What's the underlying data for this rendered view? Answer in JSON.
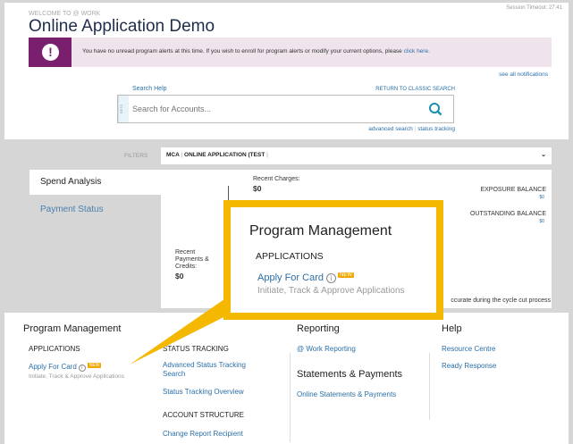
{
  "header": {
    "welcome": "WELCOME TO @ WORK",
    "title": "Online Application Demo",
    "session_timeout": "Session Timeout: 27:41"
  },
  "alert": {
    "icon": "exclamation-icon",
    "message": "You have no unread program alerts at this time. If you wish to enroll for program alerts or modify your current options, please",
    "link": "click here.",
    "see_all": "see all notifications"
  },
  "search": {
    "help": "Search Help",
    "classic": "RETURN TO CLASSIC SEARCH",
    "beta": "BETA",
    "placeholder": "Search for Accounts...",
    "advanced": "advanced search",
    "separator": "|",
    "status_tracking": "status tracking"
  },
  "filters": {
    "label": "FILTERS",
    "value_1": "MCA",
    "value_2": "ONLINE APPLICATION (TEST"
  },
  "side_tabs": [
    {
      "label": "Spend Analysis"
    },
    {
      "label": "Payment Status"
    }
  ],
  "summary": {
    "recent_charges_label": "Recent Charges:",
    "recent_charges": "$0",
    "recent_payments_label": "Recent Payments & Credits:",
    "recent_payments": "$0",
    "exposure_label": "EXPOSURE BALANCE",
    "exposure": "$0",
    "outstanding_label": "OUTSTANDING BALANCE",
    "outstanding": "$0",
    "note": "ccurate during the cycle cut process"
  },
  "callout": {
    "title": "Program Management",
    "section": "APPLICATIONS",
    "link": "Apply For Card",
    "badge": "NEW",
    "subtitle": "Initiate, Track & Approve Applications"
  },
  "menu": {
    "program_management": {
      "title": "Program Management",
      "applications": "APPLICATIONS",
      "apply": "Apply For Card",
      "badge": "NEW",
      "apply_sub": "Initiate, Track & Approve Applications",
      "status_tracking": "STATUS TRACKING",
      "advanced_1": "Advanced Status Tracking",
      "advanced_2": "Search",
      "overview": "Status Tracking Overview",
      "account_structure": "ACCOUNT STRUCTURE",
      "change_recipient": "Change Report Recipient"
    },
    "reporting": {
      "title": "Reporting",
      "work_reporting": "@ Work Reporting",
      "statements_title": "Statements & Payments",
      "online_statements": "Online Statements & Payments"
    },
    "help": {
      "title": "Help",
      "resource": "Resource Centre",
      "ready": "Ready Response"
    }
  }
}
